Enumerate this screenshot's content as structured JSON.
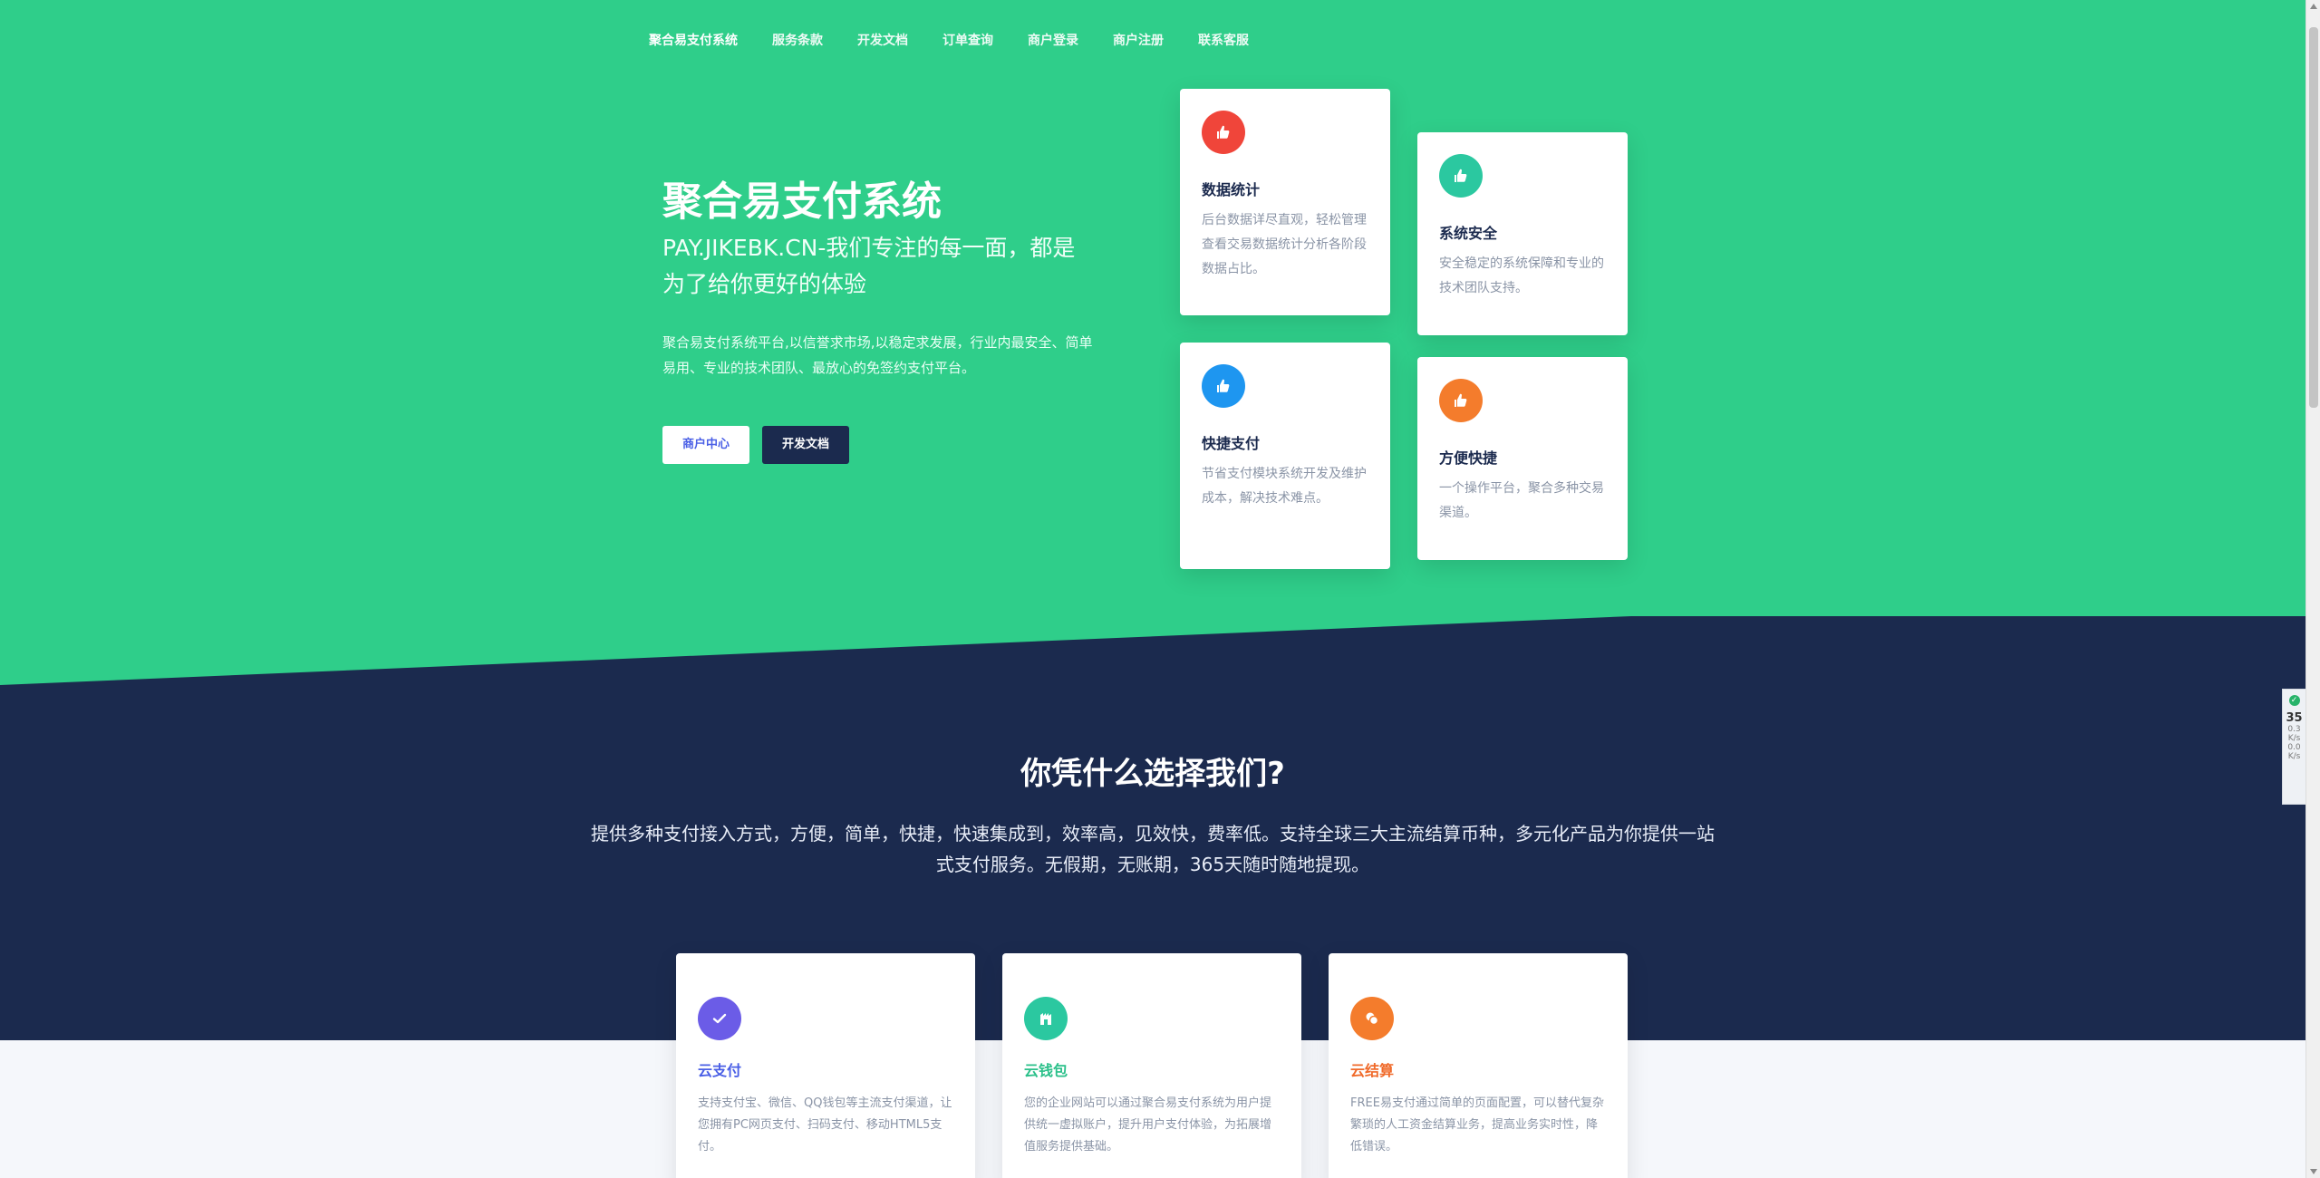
{
  "nav": {
    "brand": "聚合易支付系统",
    "items": [
      "服务条款",
      "开发文档",
      "订单查询",
      "商户登录",
      "商户注册",
      "联系客服"
    ]
  },
  "hero": {
    "title": "聚合易支付系统",
    "subtitle": "PAY.JIKEBK.CN-我们专注的每一面，都是为了给你更好的体验",
    "desc": "聚合易支付系统平台,以信誉求市场,以稳定求发展，行业内最安全、简单易用、专业的技术团队、最放心的免签约支付平台。",
    "btn_merchant": "商户中心",
    "btn_docs": "开发文档"
  },
  "features": [
    {
      "icon": "thumbs-up-icon",
      "color": "#f0453a",
      "title": "数据统计",
      "desc": "后台数据详尽直观，轻松管理查看交易数据统计分析各阶段数据占比。"
    },
    {
      "icon": "thumbs-up-icon",
      "color": "#2bc8a0",
      "title": "系统安全",
      "desc": "安全稳定的系统保障和专业的技术团队支持。"
    },
    {
      "icon": "thumbs-up-icon",
      "color": "#1e96f0",
      "title": "快捷支付",
      "desc": "节省支付模块系统开发及维护成本，解决技术难点。"
    },
    {
      "icon": "thumbs-up-icon",
      "color": "#f47c2c",
      "title": "方便快捷",
      "desc": "一个操作平台，聚合多种交易渠道。"
    }
  ],
  "why": {
    "title": "你凭什么选择我们?",
    "desc": "提供多种支付接入方式，方便，简单，快捷，快速集成到，效率高，见效快，费率低。支持全球三大主流结算币种，多元化产品为你提供一站式支付服务。无假期，无账期，365天随时随地提现。"
  },
  "products": [
    {
      "icon": "check-icon",
      "color": "#6b5ce7",
      "title_color": "#4a5fe6",
      "title": "云支付",
      "desc": "支持支付宝、微信、QQ钱包等主流支付渠道，让您拥有PC网页支付、扫码支付、移动HTML5支付。"
    },
    {
      "icon": "building-icon",
      "color": "#2bc8a0",
      "title_color": "#2bc08a",
      "title": "云钱包",
      "desc": "您的企业网站可以通过聚合易支付系统为用户提供统一虚拟账户，提升用户支付体验，为拓展增值服务提供基础。"
    },
    {
      "icon": "coins-icon",
      "color": "#f47c2c",
      "title_color": "#f06a2a",
      "title": "云结算",
      "desc": "FREE易支付通过简单的页面配置，可以替代复杂繁琐的人工资金结算业务，提高业务实时性，降低错误。"
    }
  ],
  "widget": {
    "value": "35",
    "unit1": "K/s",
    "unit2": "K/s",
    "v1": "0.3",
    "v2": "0.0"
  }
}
